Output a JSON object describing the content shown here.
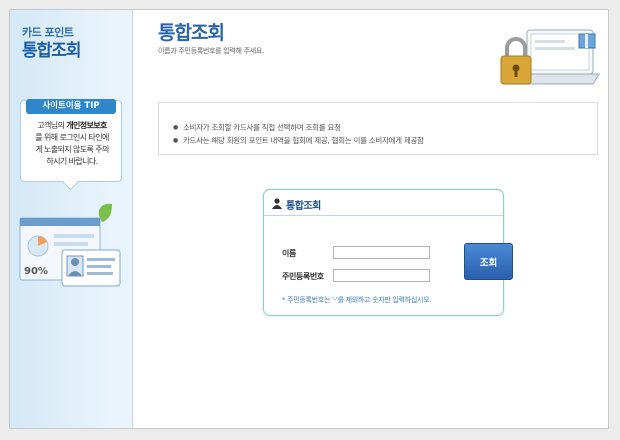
{
  "brand": {
    "subtitle": "카드 포인트",
    "title": "통합조회"
  },
  "tip": {
    "title": "사이트이용 TIP",
    "line1_pre": "고객님의 ",
    "line1_bold": "개인정보보호",
    "line2": "를 위해 로그인시 타인에",
    "line3": "게 노출되지 않도록 주의",
    "line4": "하시기 바랍니다."
  },
  "illustration": {
    "percent": "90%"
  },
  "page": {
    "title": "통합조회",
    "subtitle": "이름과 주민등록번호를 입력해 주세요."
  },
  "notices": [
    "소비자가 조회할 카드사를 직접 선택하여 조회를 요청",
    "카드사는 해당 회원의 포인트 내역을 협회에 제공, 협회는 이를 소비자에게 제공함"
  ],
  "form": {
    "title": "통합조회",
    "name_label": "이름",
    "name_value": "",
    "ssn_label": "주민등록번호",
    "ssn_value": "",
    "button_label": "조회",
    "note": "* 주민등록번호는 '-'를 제외하고 숫자만 입력하십시오."
  },
  "colors": {
    "accent": "#2a64a8",
    "button": "#2b5fae",
    "card_border": "#8fcfc3"
  }
}
